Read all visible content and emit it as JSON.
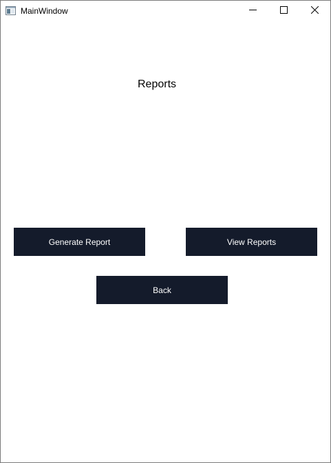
{
  "window": {
    "title": "MainWindow",
    "icon": "app-window-icon",
    "controls": {
      "minimize": "minimize-icon",
      "maximize": "maximize-icon",
      "close": "close-icon"
    }
  },
  "main": {
    "heading": "Reports",
    "buttons": {
      "generate_label": "Generate Report",
      "view_label": "View Reports",
      "back_label": "Back"
    }
  },
  "colors": {
    "button_background": "#141b2b",
    "button_text": "#ffffff",
    "window_background": "#ffffff"
  }
}
